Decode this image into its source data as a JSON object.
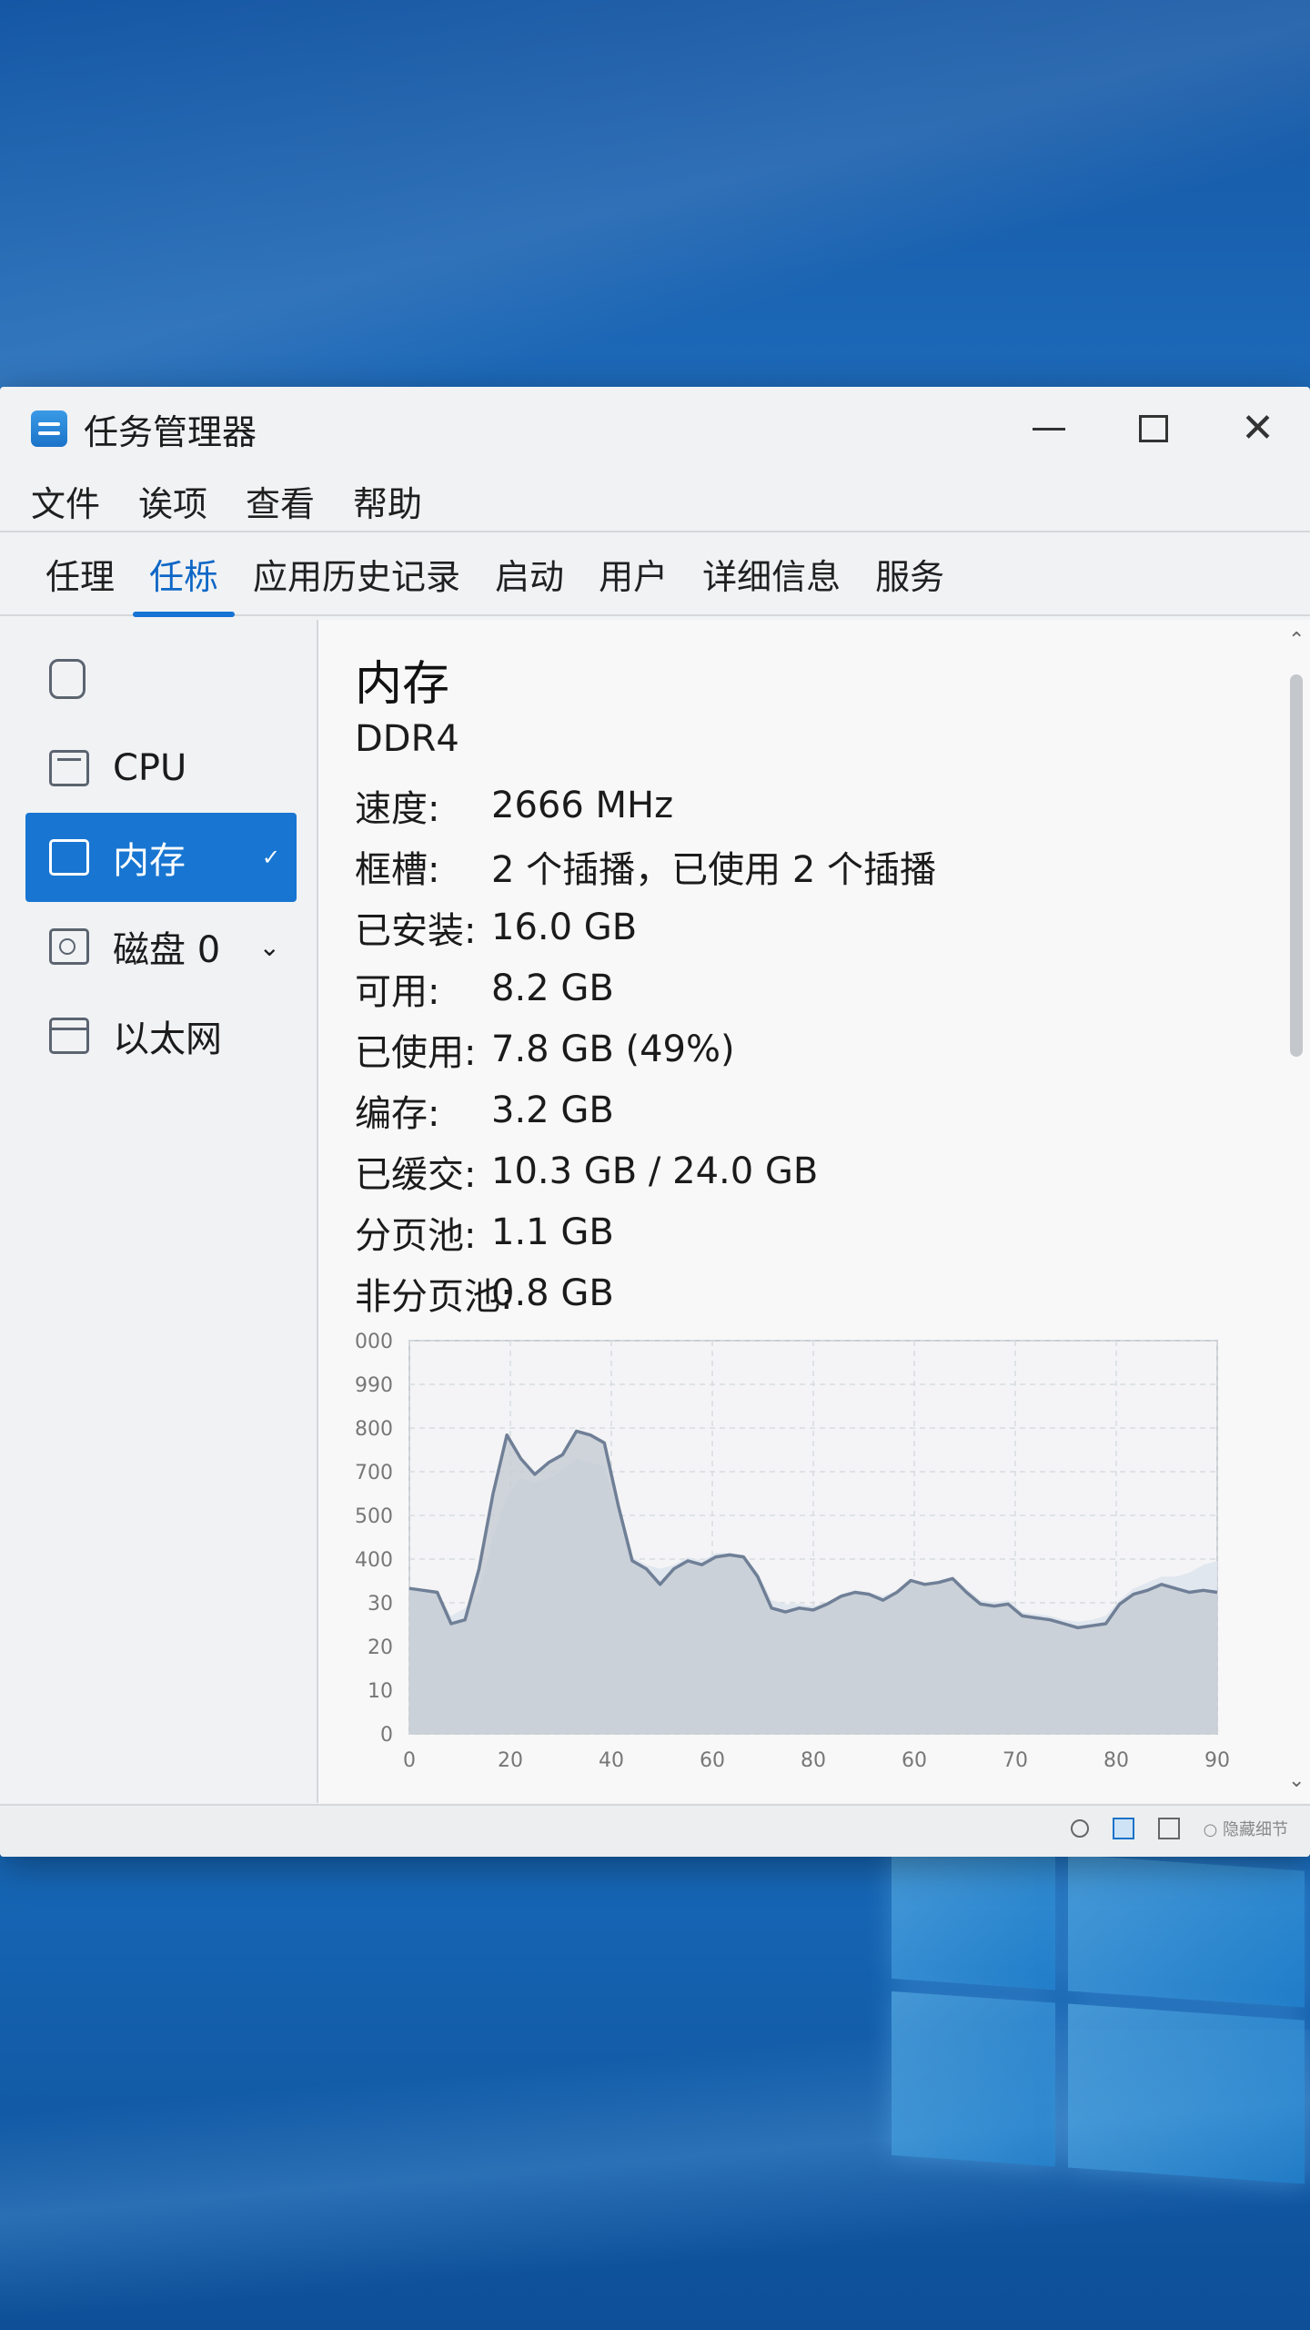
{
  "window": {
    "title": "任务管理器",
    "controls": {
      "minimize": "minimize",
      "maximize": "maximize",
      "close": "✕"
    }
  },
  "menu": [
    "文件",
    "诶项",
    "查看",
    "帮助"
  ],
  "tabs": [
    {
      "label": "任理",
      "active": false
    },
    {
      "label": "任栎",
      "active": true
    },
    {
      "label": "应用历史记录",
      "active": false
    },
    {
      "label": "启动",
      "active": false
    },
    {
      "label": "用户",
      "active": false
    },
    {
      "label": "详细信息",
      "active": false
    },
    {
      "label": "服务",
      "active": false
    }
  ],
  "sidebar": {
    "items": [
      {
        "label": "",
        "icon": "refresh-icon",
        "selected": false,
        "chevron": ""
      },
      {
        "label": "CPU",
        "icon": "cpu-icon",
        "selected": false,
        "chevron": ""
      },
      {
        "label": "内存",
        "icon": "memory-icon",
        "selected": true,
        "chevron": "✓"
      },
      {
        "label": "磁盘 0",
        "icon": "disk-icon",
        "selected": false,
        "chevron": "⌄"
      },
      {
        "label": "以太网",
        "icon": "ethernet-icon",
        "selected": false,
        "chevron": ""
      }
    ]
  },
  "main": {
    "title": "内存",
    "subtitle": "DDR4",
    "stats": [
      {
        "label": "速度:",
        "value": "2666 MHz"
      },
      {
        "label": "框槽:",
        "value": "2 个插播，已使用 2 个插播"
      },
      {
        "label": "已安装:",
        "value": "16.0 GB"
      },
      {
        "label": "可用:",
        "value": "8.2 GB"
      },
      {
        "label": "已使用:",
        "value": "7.8 GB (49%)"
      },
      {
        "label": "编存:",
        "value": "3.2 GB"
      },
      {
        "label": "已缓交:",
        "value": "10.3 GB / 24.0 GB"
      },
      {
        "label": "分页池:",
        "value": "1.1 GB"
      },
      {
        "label": "非分页池:",
        "value": "0.8 GB"
      }
    ]
  },
  "chart_data": {
    "type": "area",
    "x_ticks": [
      "0",
      "20",
      "40",
      "60",
      "80",
      "60",
      "70",
      "80",
      "90"
    ],
    "y_ticks": [
      "000",
      "990",
      "800",
      "700",
      "500",
      "400",
      "30",
      "20",
      "10",
      "0"
    ],
    "values": [
      370,
      365,
      360,
      280,
      290,
      420,
      610,
      760,
      700,
      660,
      690,
      710,
      770,
      760,
      740,
      580,
      440,
      420,
      380,
      420,
      440,
      430,
      450,
      455,
      450,
      400,
      320,
      310,
      320,
      315,
      330,
      350,
      360,
      355,
      340,
      360,
      390,
      380,
      385,
      395,
      360,
      330,
      325,
      330,
      300,
      295,
      290,
      280,
      270,
      275,
      280,
      330,
      355,
      365,
      380,
      370,
      360,
      365,
      360
    ],
    "background_values": [
      370,
      365,
      360,
      300,
      320,
      360,
      500,
      600,
      650,
      640,
      650,
      670,
      700,
      690,
      680,
      560,
      450,
      430,
      420,
      430,
      450,
      440,
      460,
      460,
      455,
      410,
      340,
      330,
      330,
      325,
      335,
      355,
      365,
      360,
      350,
      365,
      390,
      385,
      390,
      400,
      370,
      340,
      335,
      340,
      310,
      305,
      300,
      290,
      285,
      290,
      300,
      340,
      370,
      385,
      400,
      400,
      410,
      430,
      440
    ],
    "y_range": [
      0,
      1000
    ],
    "grid": true,
    "colors": {
      "line": "#6f7f96",
      "fill": "#c3c9d2",
      "back_fill": "#dfe6ee",
      "grid": "#d7dbe0"
    }
  },
  "status": {
    "text": "○ 隐藏细节"
  }
}
